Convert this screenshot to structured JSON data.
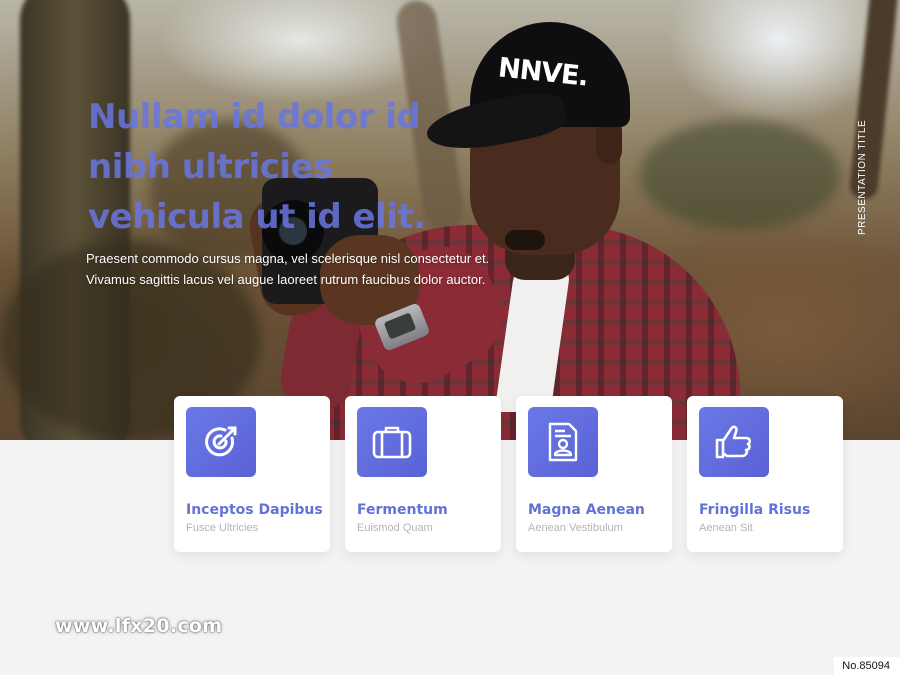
{
  "hero": {
    "headline": "Nullam id dolor id nibh ultricies vehicula ut id elit.",
    "subtext": "Praesent commodo cursus magna, vel scelerisque nisl consectetur et. Vivamus sagittis lacus vel augue laoreet rutrum faucibus dolor auctor.",
    "side_label": "PRESENTATION TITLE",
    "cap_logo": "NNVE."
  },
  "features": [
    {
      "title": "Inceptos Dapibus",
      "subtitle": "Fusce Ultricies",
      "icon": "target-arrow-icon"
    },
    {
      "title": "Fermentum",
      "subtitle": "Euismod Quam",
      "icon": "briefcase-icon"
    },
    {
      "title": "Magna Aenean",
      "subtitle": "Aenean Vestibulum",
      "icon": "id-document-icon"
    },
    {
      "title": "Fringilla Risus",
      "subtitle": "Aenean Sit",
      "icon": "thumbs-up-icon"
    }
  ],
  "footer": {
    "watermark": "www.lfx20.com",
    "item_number": "No.85094"
  },
  "colors": {
    "accent": "#6372d6",
    "headline": "#6876e0",
    "background": "#f3f3f4",
    "card": "#ffffff",
    "subtitle": "#b4b4b8"
  }
}
